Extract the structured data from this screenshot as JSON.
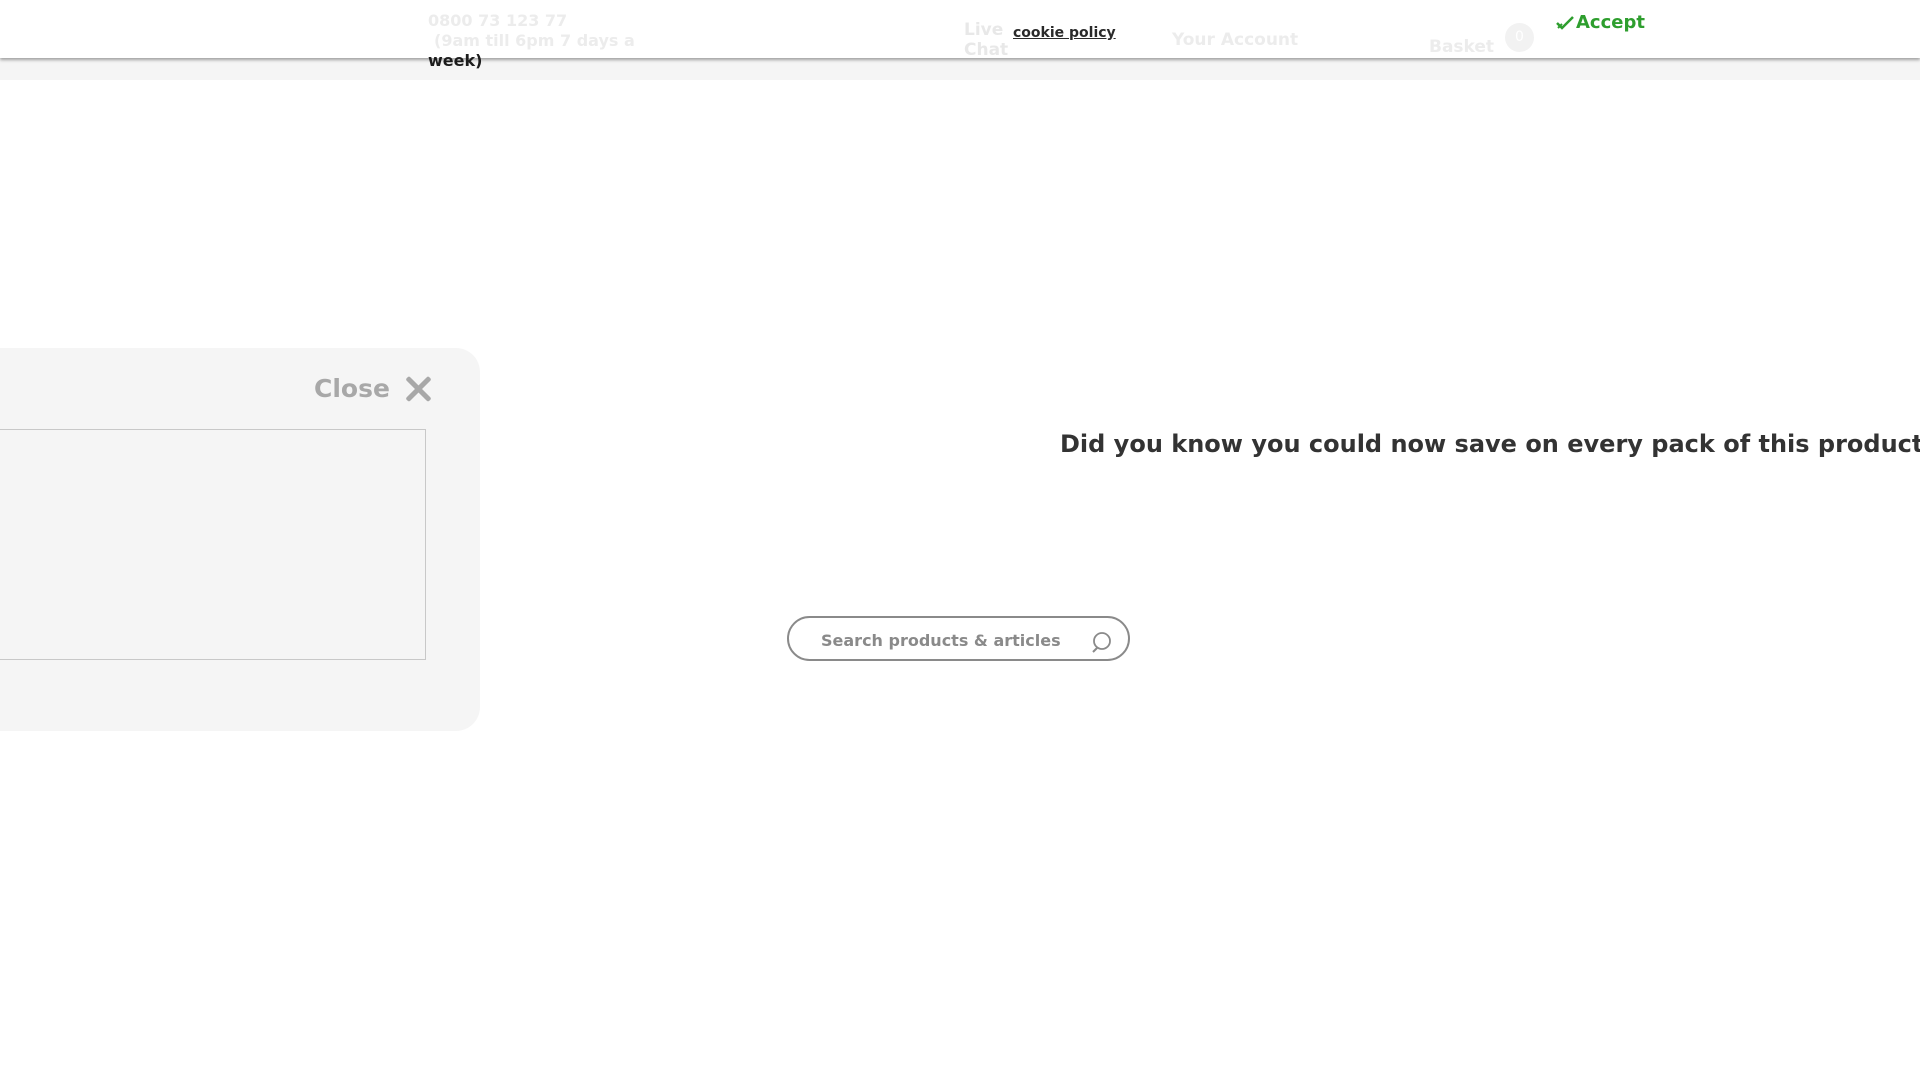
{
  "header": {
    "phone_number": "0800 73 123 77",
    "phone_hours": "(9am till 6pm 7 days a",
    "phone_hours_end": "week)",
    "live_chat": "Live Chat",
    "cookie_policy": "cookie policy",
    "your_account": "Your Account",
    "basket_label": "Basket",
    "basket_count": "0",
    "accept_label": "Accept",
    "accept_icon": "check-icon"
  },
  "panel": {
    "close_label": "Close",
    "close_icon": "close-icon"
  },
  "promo": {
    "text": "Did you know you could now save on every pack of this product, ev"
  },
  "search": {
    "placeholder": "Search products & articles",
    "icon": "search-icon"
  },
  "colors": {
    "accept_green": "#2e9e2e",
    "panel_bg": "#f5f5f5",
    "close_grey": "#a8a8a8"
  }
}
